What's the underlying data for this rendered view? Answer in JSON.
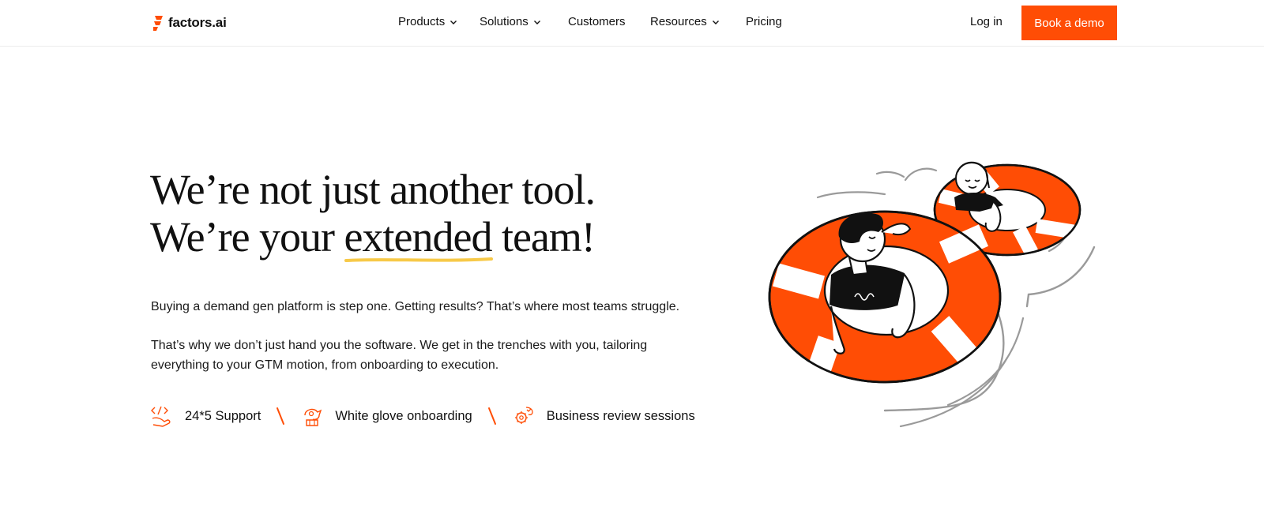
{
  "brand": {
    "name": "factors.ai",
    "accent": "#ff4d05",
    "highlight": "#f7c948"
  },
  "nav": {
    "items": [
      {
        "label": "Products",
        "has_dropdown": true
      },
      {
        "label": "Solutions",
        "has_dropdown": true
      },
      {
        "label": "Customers",
        "has_dropdown": false
      },
      {
        "label": "Resources",
        "has_dropdown": true
      },
      {
        "label": "Pricing",
        "has_dropdown": false
      }
    ],
    "login_label": "Log in",
    "cta_label": "Book a demo"
  },
  "hero": {
    "headline_line1": "We’re not just another tool.",
    "headline_line2_pre": "We’re your ",
    "headline_line2_highlight": "extended",
    "headline_line2_post": " team!",
    "paragraph1": "Buying a demand gen platform is step one. Getting results? That’s where most teams struggle.",
    "paragraph2": "That’s why we don’t just hand you the software. We get in the trenches with you, tailoring everything to your GTM motion, from onboarding to execution."
  },
  "features": [
    {
      "label": "24*5 Support",
      "icon": "code-support-icon"
    },
    {
      "label": "White glove onboarding",
      "icon": "glove-onboarding-icon"
    },
    {
      "label": "Business review sessions",
      "icon": "gear-review-icon"
    }
  ],
  "illustration": {
    "icon": "lifebuoy-floating-people-illustration"
  }
}
